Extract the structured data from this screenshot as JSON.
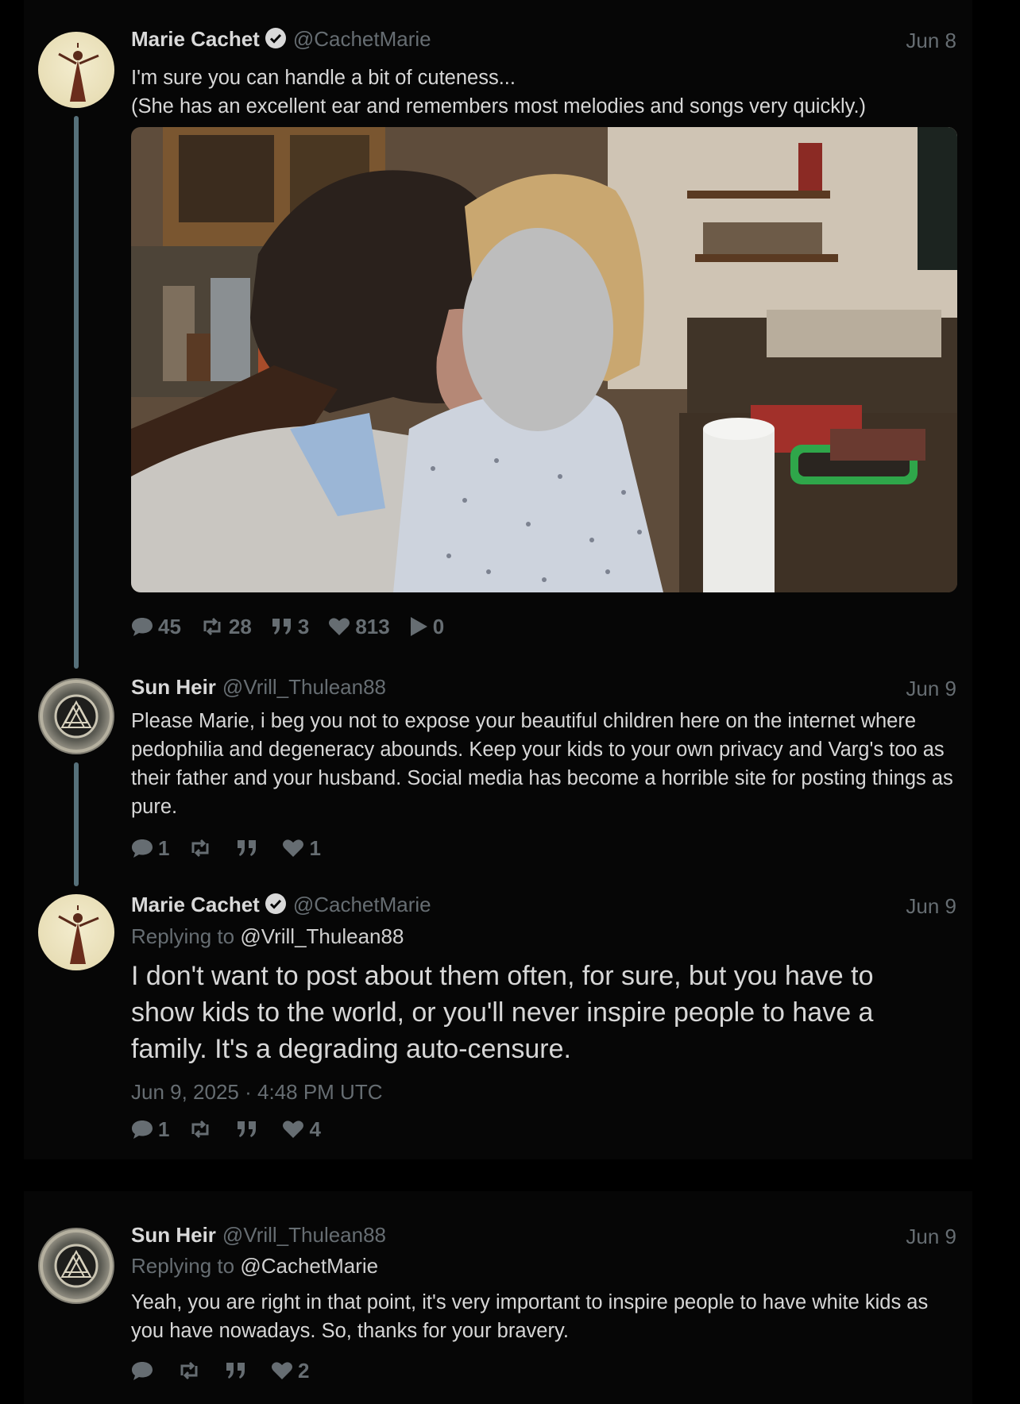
{
  "tweets": [
    {
      "name": "Marie Cachet",
      "handle": "@CachetMarie",
      "date": "Jun 8",
      "text_lines": [
        "I'm sure you can handle a bit of cuteness...",
        "(She has an excellent ear and remembers most melodies and songs very quickly.)"
      ],
      "stats": {
        "comments": "45",
        "retweets": "28",
        "quotes": "3",
        "likes": "813",
        "plays": "0"
      }
    },
    {
      "name": "Sun Heir",
      "handle": "@Vrill_Thulean88",
      "date": "Jun 9",
      "text": "Please Marie, i beg you not to expose your beautiful children here on the internet where pedophilia and degeneracy abounds. Keep your kids to your own privacy and Varg's too as their father and your husband. Social media has become a horrible site for posting things as pure.",
      "stats": {
        "comments": "1",
        "retweets": "",
        "quotes": "",
        "likes": "1"
      }
    },
    {
      "name": "Marie Cachet",
      "handle": "@CachetMarie",
      "date": "Jun 9",
      "replying_label": "Replying to",
      "replying_handle": "@Vrill_Thulean88",
      "text": "I don't want to post about them often, for sure, but you have to show kids to the world, or you'll never inspire people to have a family. It's a degrading auto-censure.",
      "timestamp": "Jun 9, 2025 · 4:48 PM UTC",
      "stats": {
        "comments": "1",
        "retweets": "",
        "quotes": "",
        "likes": "4"
      }
    },
    {
      "name": "Sun Heir",
      "handle": "@Vrill_Thulean88",
      "date": "Jun 9",
      "replying_label": "Replying to",
      "replying_handle": "@CachetMarie",
      "text": "Yeah, you are right in that point, it's very important to inspire people to have white kids as you have nowadays. So, thanks for your bravery.",
      "stats": {
        "comments": "",
        "retweets": "",
        "quotes": "",
        "likes": "2"
      }
    }
  ],
  "colors": {
    "background": "#000000",
    "panel": "#060606",
    "muted": "#666d72",
    "text": "#d9d9d9",
    "thread_line": "#56707a",
    "verified": "#d9d9d9"
  },
  "icons": [
    "verified-badge-icon",
    "comment-icon",
    "retweet-icon",
    "quote-icon",
    "heart-icon",
    "play-icon"
  ]
}
